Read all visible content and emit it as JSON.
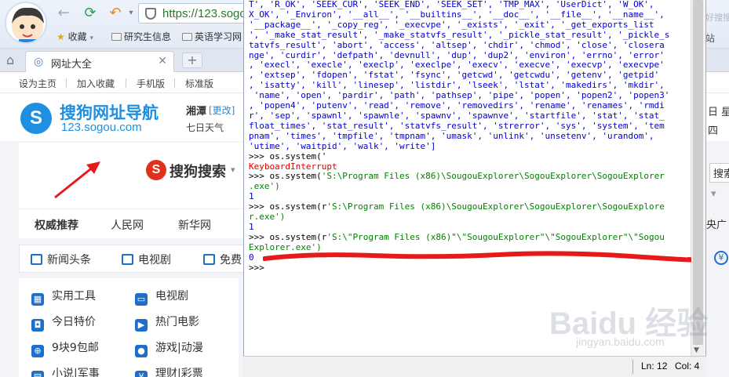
{
  "browser": {
    "url": "https://123.sogou",
    "bookmarks": [
      {
        "label": "收藏"
      },
      {
        "label": "研究生信息"
      },
      {
        "label": "英语学习网"
      }
    ],
    "right_fragments": {
      "top": "好搜搜",
      "folder": "站"
    },
    "tab": {
      "label": "网址大全"
    },
    "site_links": [
      "设为主页",
      "加入收藏",
      "手机版",
      "标准版"
    ],
    "page": {
      "logo_title": "搜狗网址导航",
      "logo_subtitle": "123.sogou.com",
      "city": "湘潭",
      "city_change": "[更改]",
      "weather": "七日天气",
      "search_engine": "搜狗搜索",
      "authority_links": [
        "权威推荐",
        "人民网",
        "新华网"
      ],
      "news_tabs": [
        "新闻头条",
        "电视剧",
        "免费"
      ],
      "categories": [
        {
          "label": "实用工具",
          "icon": "grid-icon"
        },
        {
          "label": "电视剧",
          "icon": "tv-icon"
        },
        {
          "label": "今日特价",
          "icon": "bag-icon"
        },
        {
          "label": "热门电影",
          "icon": "film-icon"
        },
        {
          "label": "9块9包邮",
          "icon": "cart-icon"
        },
        {
          "label": "游戏|动漫",
          "icon": "gamer-icon"
        },
        {
          "label": "小说|军事",
          "icon": "book-icon"
        },
        {
          "label": "理财|彩票",
          "icon": "yen-icon"
        }
      ],
      "right_fragments": [
        "日 星期",
        "四",
        "搜索",
        "央广"
      ]
    }
  },
  "shell": {
    "lines": [
      {
        "t": "T', 'R_OK', 'SEEK_CUR', 'SEEK_END', 'SEEK_SET', 'TMP_MAX', 'UserDict', 'W_OK',",
        "c": "b"
      },
      {
        "t": "X_OK', '_Environ', '__all__', '__builtins__', '__doc__', '__file__', '__name__',",
        "c": "b"
      },
      {
        "t": "'__package__', '_copy_reg', '_execvpe', '_exists', '_exit', '_get_exports_list",
        "c": "b"
      },
      {
        "t": "', '_make_stat_result', '_make_statvfs_result', '_pickle_stat_result', '_pickle_s",
        "c": "b"
      },
      {
        "t": "tatvfs_result', 'abort', 'access', 'altsep', 'chdir', 'chmod', 'close', 'closera",
        "c": "b"
      },
      {
        "t": "nge', 'curdir', 'defpath', 'devnull', 'dup', 'dup2', 'environ', 'errno', 'error'",
        "c": "b"
      },
      {
        "t": ", 'execl', 'execle', 'execlp', 'execlpe', 'execv', 'execve', 'execvp', 'execvpe'",
        "c": "b"
      },
      {
        "t": ", 'extsep', 'fdopen', 'fstat', 'fsync', 'getcwd', 'getcwdu', 'getenv', 'getpid'",
        "c": "b"
      },
      {
        "t": ", 'isatty', 'kill', 'linesep', 'listdir', 'lseek', 'lstat', 'makedirs', 'mkdir',",
        "c": "b"
      },
      {
        "t": " 'name', 'open', 'pardir', 'path', 'pathsep', 'pipe', 'popen', 'popen2', 'popen3'",
        "c": "b"
      },
      {
        "t": ", 'popen4', 'putenv', 'read', 'remove', 'removedirs', 'rename', 'renames', 'rmdi",
        "c": "b"
      },
      {
        "t": "r', 'sep', 'spawnl', 'spawnle', 'spawnv', 'spawnve', 'startfile', 'stat', 'stat_",
        "c": "b"
      },
      {
        "t": "float_times', 'stat_result', 'statvfs_result', 'strerror', 'sys', 'system', 'tem",
        "c": "b"
      },
      {
        "t": "pnam', 'times', 'tmpfile', 'tmpnam', 'umask', 'unlink', 'unsetenv', 'urandom',",
        "c": "b"
      },
      {
        "t": "'utime', 'waitpid', 'walk', 'write']",
        "c": "b"
      },
      {
        "t": ">>> os.system('",
        "c": "k"
      },
      {
        "t": "KeyboardInterrupt",
        "c": "r"
      },
      {
        "t": ">>> os.system('S:\\Program Files (x86)\\SougouExplorer\\SogouExplorer\\SogouExplorer",
        "c": "k",
        "g": "'S:\\Program Files (x86)\\SougouExplorer\\SogouExplorer\\SogouExplorer"
      },
      {
        "t": ".exe')",
        "c": "g"
      },
      {
        "t": "1",
        "c": "b"
      },
      {
        "t": ">>> os.system(r'S:\\Program Files (x86)\\SougouExplorer\\SogouExplorer\\SogouExplore",
        "c": "k",
        "g": "'S:\\Program Files (x86)\\SougouExplorer\\SogouExplorer\\SogouExplore"
      },
      {
        "t": "r.exe')",
        "c": "g"
      },
      {
        "t": "1",
        "c": "b"
      },
      {
        "t": ">>> os.system(r'S:\\\"Program Files (x86)\"\\\"SougouExplorer\"\\\"SogouExplorer\"\\\"Sogou",
        "c": "k",
        "g": "'S:\\\"Program Files (x86)\"\\\"SougouExplorer\"\\\"SogouExplorer\"\\\"Sogou"
      },
      {
        "t": "Explorer.exe')",
        "c": "g"
      },
      {
        "t": "0",
        "c": "b"
      },
      {
        "t": ">>>",
        "c": "k"
      }
    ],
    "status_line": "Ln: 12",
    "status_col": "Col: 4"
  },
  "watermark": {
    "text": "Baidu 经验",
    "sub": "jingyan.baidu.com"
  },
  "colors": {
    "accent": "#1e8fe1",
    "underline": "#e8191b",
    "shell_green": "#008000",
    "shell_red": "#dd0000",
    "shell_blue": "#0000cc"
  }
}
